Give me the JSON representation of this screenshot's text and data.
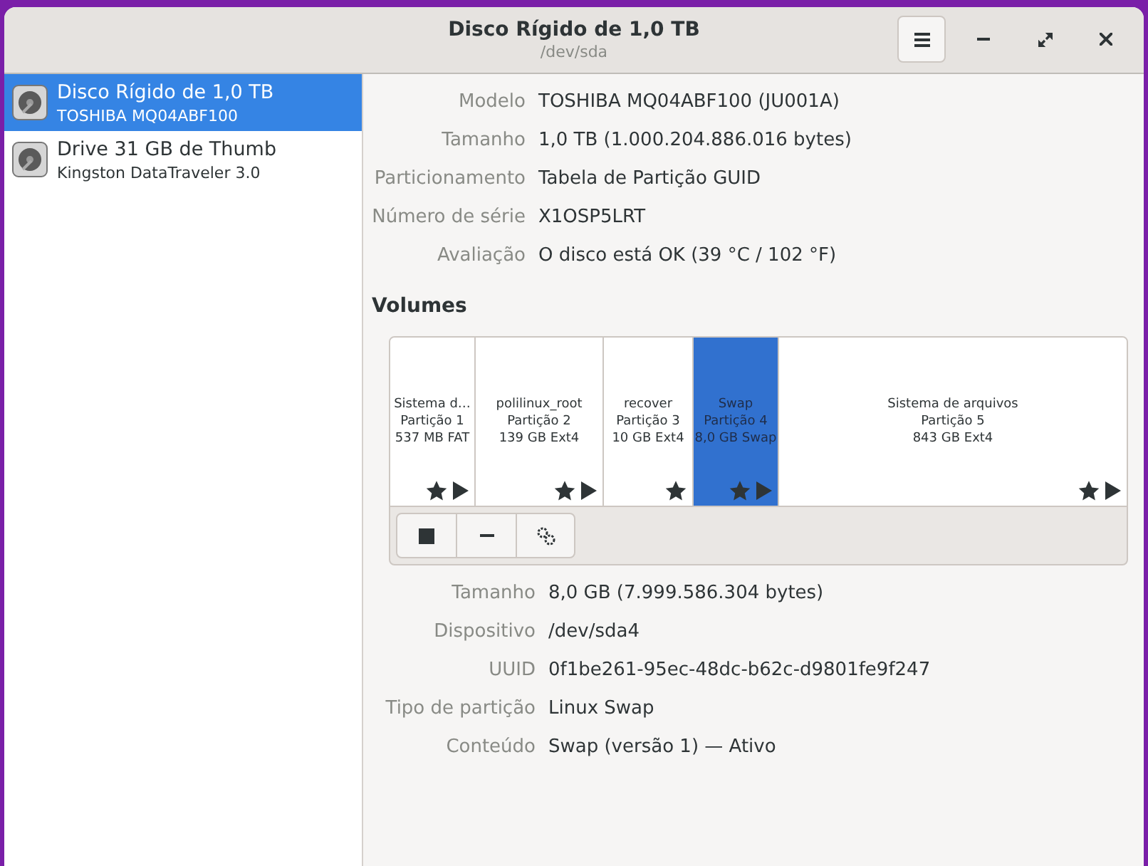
{
  "window": {
    "title": "Disco Rígido de 1,0 TB",
    "subtitle": "/dev/sda"
  },
  "sidebar": {
    "items": [
      {
        "title": "Disco Rígido de 1,0 TB",
        "subtitle": "TOSHIBA MQ04ABF100",
        "selected": true
      },
      {
        "title": "Drive 31 GB de Thumb",
        "subtitle": "Kingston DataTraveler 3.0",
        "selected": false
      }
    ]
  },
  "disk_info": [
    {
      "label": "Modelo",
      "value": "TOSHIBA MQ04ABF100 (JU001A)"
    },
    {
      "label": "Tamanho",
      "value": "1,0 TB (1.000.204.886.016 bytes)"
    },
    {
      "label": "Particionamento",
      "value": "Tabela de Partição GUID"
    },
    {
      "label": "Número de série",
      "value": "X1OSP5LRT"
    },
    {
      "label": "Avaliação",
      "value": "O disco está OK (39 °C / 102 °F)"
    }
  ],
  "volumes": {
    "heading": "Volumes",
    "partitions": [
      {
        "name": "Sistema d…",
        "number": "Partição 1",
        "size": "537 MB FAT",
        "selected": false,
        "star": true,
        "arrow": true
      },
      {
        "name": "polilinux_root",
        "number": "Partição 2",
        "size": "139 GB Ext4",
        "selected": false,
        "star": true,
        "arrow": true
      },
      {
        "name": "recover",
        "number": "Partição 3",
        "size": "10 GB Ext4",
        "selected": false,
        "star": true,
        "arrow": false
      },
      {
        "name": "Swap",
        "number": "Partição 4",
        "size": "8,0 GB Swap",
        "selected": true,
        "star": true,
        "arrow": true
      },
      {
        "name": "Sistema de arquivos",
        "number": "Partição 5",
        "size": "843 GB Ext4",
        "selected": false,
        "star": true,
        "arrow": true
      }
    ]
  },
  "partition_info": [
    {
      "label": "Tamanho",
      "value": "8,0 GB (7.999.586.304 bytes)"
    },
    {
      "label": "Dispositivo",
      "value": "/dev/sda4"
    },
    {
      "label": "UUID",
      "value": "0f1be261-95ec-48dc-b62c-d9801fe9f247"
    },
    {
      "label": "Tipo de partição",
      "value": "Linux Swap"
    },
    {
      "label": "Conteúdo",
      "value": "Swap (versão 1) — Ativo"
    }
  ]
}
